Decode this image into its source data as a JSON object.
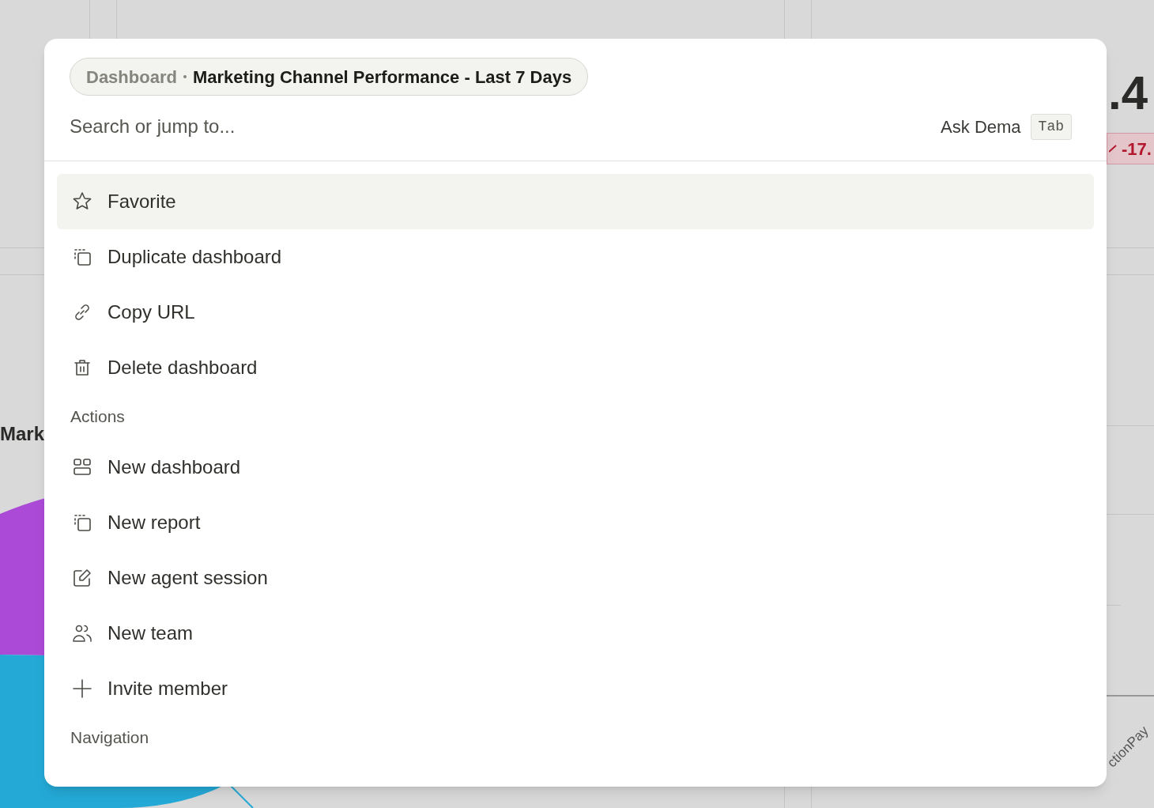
{
  "background": {
    "metric_value": ".4",
    "metric_change": "-17.",
    "chart_title": "Mark",
    "axis_labels": [
      "ctionPay"
    ]
  },
  "palette": {
    "breadcrumb": {
      "section": "Dashboard",
      "title": "Marketing Channel Performance - Last 7 Days"
    },
    "search": {
      "placeholder": "Search or jump to..."
    },
    "ask": {
      "label": "Ask Dema",
      "shortcut": "Tab"
    },
    "groups": [
      {
        "items": [
          {
            "label": "Favorite",
            "selected": true
          },
          {
            "label": "Duplicate dashboard",
            "selected": false
          },
          {
            "label": "Copy URL",
            "selected": false
          },
          {
            "label": "Delete dashboard",
            "selected": false
          }
        ]
      },
      {
        "heading": "Actions",
        "items": [
          {
            "label": "New dashboard",
            "selected": false
          },
          {
            "label": "New report",
            "selected": false
          },
          {
            "label": "New agent session",
            "selected": false
          },
          {
            "label": "New team",
            "selected": false
          },
          {
            "label": "Invite member",
            "selected": false
          }
        ]
      },
      {
        "heading": "Navigation"
      }
    ]
  }
}
